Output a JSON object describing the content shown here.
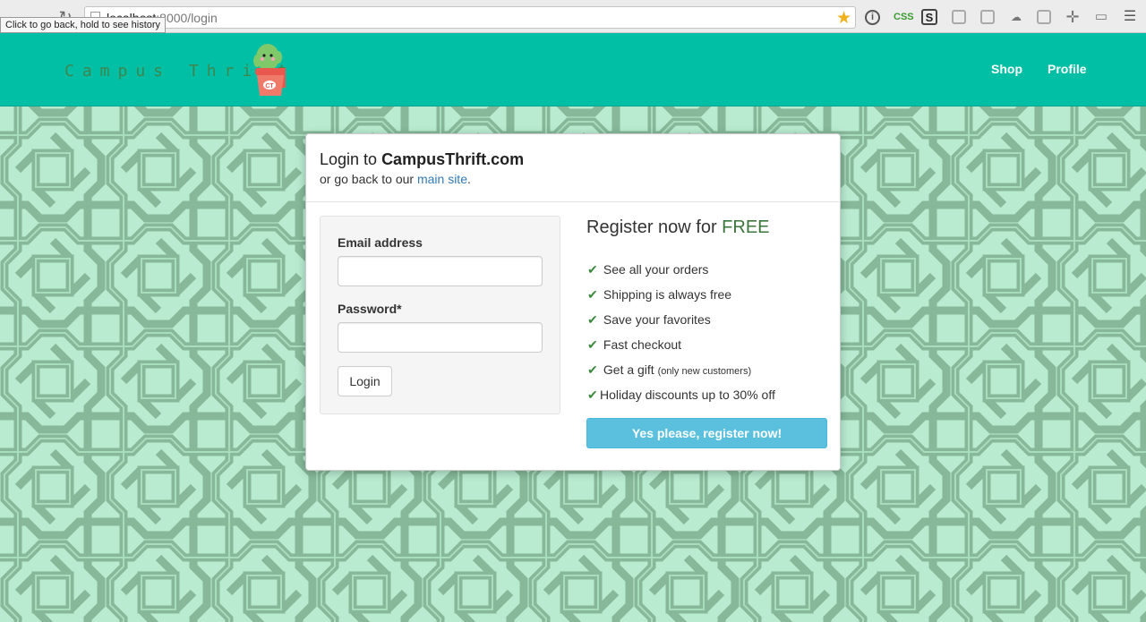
{
  "browser": {
    "url_host": "localhost",
    "url_rest": ":8000/login",
    "tooltip": "Click to go back, hold to see history",
    "extensions": [
      "info-icon",
      "css-icon",
      "s-icon",
      "puzzle-icon",
      "dss-icon",
      "cloud-icon",
      "camera-icon",
      "crosshair-icon",
      "cast-icon",
      "menu-icon"
    ],
    "ext_labels": {
      "css": "CSS",
      "s": "S"
    }
  },
  "header": {
    "brand": "Campus Thrift",
    "mascot_badge": "CT",
    "nav": [
      {
        "label": "Shop"
      },
      {
        "label": "Profile"
      }
    ]
  },
  "login": {
    "title_prefix": "Login to ",
    "title_site": "CampusThrift.com",
    "subtitle_prefix": "or go back to our ",
    "subtitle_link": "main site",
    "subtitle_suffix": ".",
    "email_label": "Email address",
    "email_value": "",
    "password_label": "Password*",
    "password_value": "",
    "login_button": "Login"
  },
  "register": {
    "title_prefix": "Register now for ",
    "title_free": "FREE",
    "benefits": [
      {
        "text": "See all your orders",
        "note": ""
      },
      {
        "text": "Shipping is always free",
        "note": ""
      },
      {
        "text": "Save your favorites",
        "note": ""
      },
      {
        "text": "Fast checkout",
        "note": ""
      },
      {
        "text": "Get a gift ",
        "note": "(only new customers)"
      },
      {
        "text": "Holiday discounts up to 30% off",
        "note": ""
      }
    ],
    "button": "Yes please, register now!"
  },
  "colors": {
    "header_bg": "#00bfa5",
    "page_bg": "#b8ebd0",
    "pattern": "#86b899",
    "register_btn": "#5bc0de",
    "check": "#3c8a3e",
    "free_text": "#3c763d",
    "link": "#337ab7"
  }
}
